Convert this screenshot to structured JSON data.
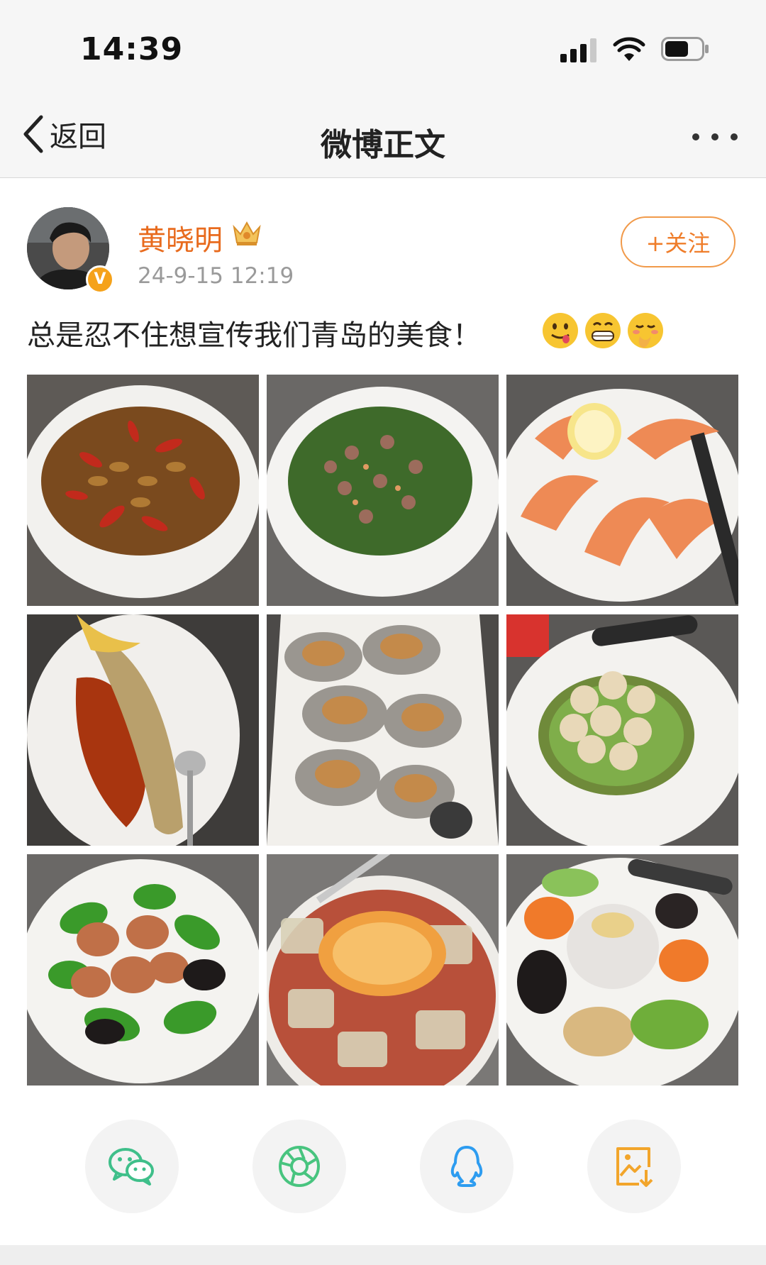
{
  "status_bar": {
    "time": "14:39"
  },
  "nav": {
    "back_label": "返回",
    "title": "微博正文"
  },
  "post": {
    "author": "黄晓明",
    "timestamp": "24-9-15 12:19",
    "follow_label": "+关注",
    "text": "总是忍不住想宣传我们青岛的美食！",
    "emojis": [
      "yummy-face-icon",
      "grin-face-icon",
      "shy-face-icon"
    ]
  },
  "photos": [
    {
      "name": "fried-silkworm-pupae-chili"
    },
    {
      "name": "stir-fried-squid-chives"
    },
    {
      "name": "boiled-shrimp-lemon"
    },
    {
      "name": "steamed-yellow-croaker"
    },
    {
      "name": "garlic-baked-oysters"
    },
    {
      "name": "scallops-cucumber-shreds"
    },
    {
      "name": "stir-fried-intestines-peppers"
    },
    {
      "name": "jelly-noodles-dried-shrimp"
    },
    {
      "name": "cold-salad-platter"
    }
  ],
  "share": [
    {
      "name": "wechat-icon",
      "color": "#3fbf8a"
    },
    {
      "name": "moments-icon",
      "color": "#48c47f"
    },
    {
      "name": "qq-icon",
      "color": "#2d9cf0"
    },
    {
      "name": "save-image-icon",
      "color": "#f2a52b"
    }
  ],
  "colors": {
    "accent": "#e86b1e",
    "follow_border": "#f19a4a"
  }
}
